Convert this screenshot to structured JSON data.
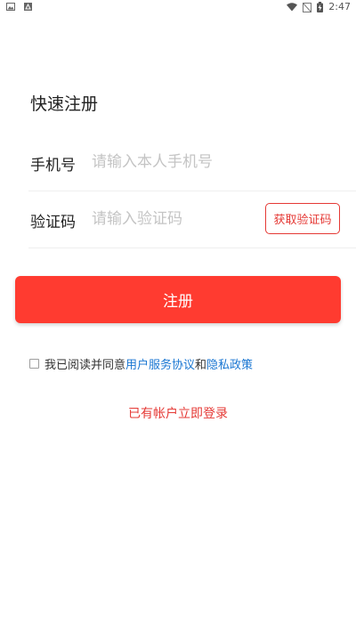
{
  "status_bar": {
    "time": "2:47"
  },
  "page": {
    "title": "快速注册"
  },
  "form": {
    "phone": {
      "label": "手机号",
      "placeholder": "请输入本人手机号",
      "value": ""
    },
    "code": {
      "label": "验证码",
      "placeholder": "请输入验证码",
      "value": "",
      "get_code_label": "获取验证码"
    }
  },
  "register_button": {
    "label": "注册"
  },
  "agreement": {
    "checked": false,
    "prefix": "我已阅读并同意",
    "terms_link": "用户服务协议",
    "conjunction": "和",
    "privacy_link": "隐私政策"
  },
  "login_link": {
    "label": "已有帐户立即登录"
  },
  "colors": {
    "primary_red": "#ff3b30",
    "link_red": "#e53935",
    "link_blue": "#1976d2",
    "placeholder_gray": "#c4c4c4"
  }
}
